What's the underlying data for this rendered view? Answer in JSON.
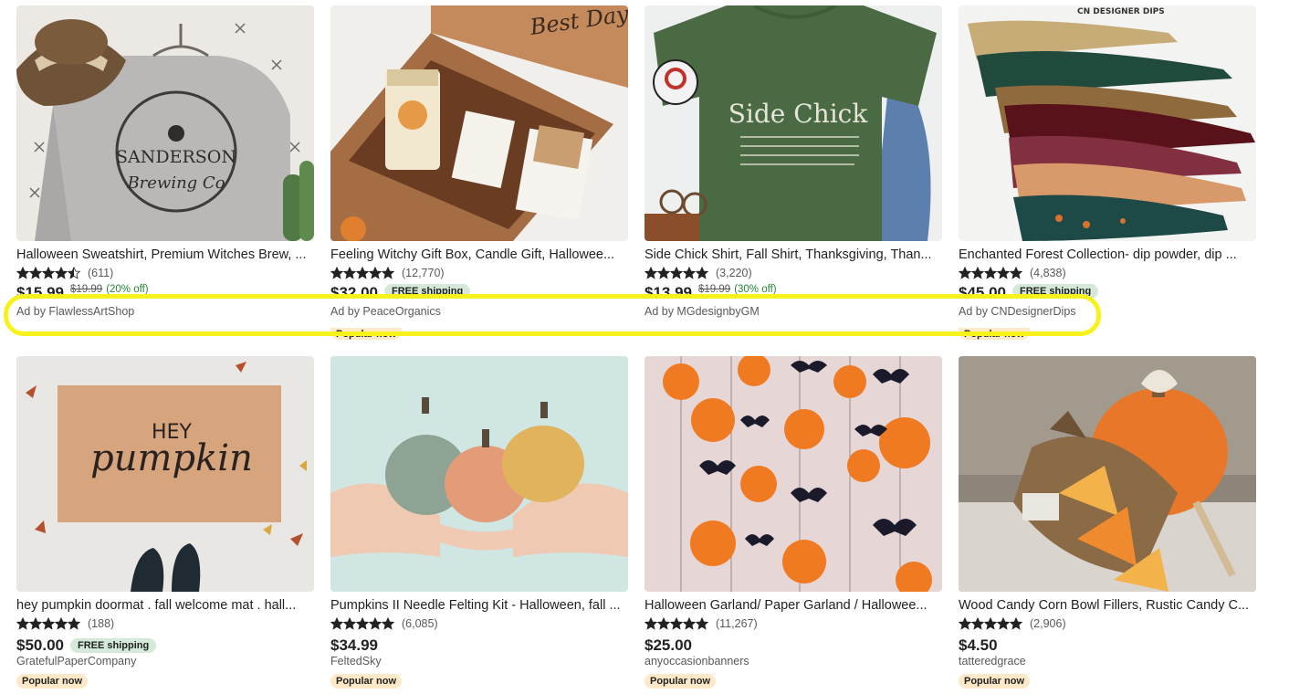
{
  "highlight_color": "#f7f21c",
  "listings": [
    {
      "title": "Halloween Sweatshirt, Premium Witches Brew, ...",
      "stars": 4.5,
      "reviews": "(611)",
      "price": "$15.99",
      "original": "$19.99",
      "discount": "(20% off)",
      "shipping": "",
      "ad": "Ad by FlawlessArtShop",
      "shop": "",
      "badge": "",
      "image": "sweatshirt"
    },
    {
      "title": "Feeling Witchy Gift Box, Candle Gift, Hallowee...",
      "stars": 5,
      "reviews": "(12,770)",
      "price": "$32.00",
      "original": "",
      "discount": "",
      "shipping": "FREE shipping",
      "ad": "Ad by PeaceOrganics",
      "shop": "",
      "badge": "Popular now",
      "image": "giftbox"
    },
    {
      "title": "Side Chick Shirt, Fall Shirt, Thanksgiving, Than...",
      "stars": 5,
      "reviews": "(3,220)",
      "price": "$13.99",
      "original": "$19.99",
      "discount": "(30% off)",
      "shipping": "",
      "ad": "Ad by MGdesignbyGM",
      "shop": "",
      "badge": "",
      "image": "tshirt"
    },
    {
      "title": "Enchanted Forest Collection- dip powder, dip ...",
      "stars": 5,
      "reviews": "(4,838)",
      "price": "$45.00",
      "original": "",
      "discount": "",
      "shipping": "FREE shipping",
      "ad": "Ad by CNDesignerDips",
      "shop": "",
      "badge": "Popular now",
      "image": "nails",
      "image_text": "CN DESIGNER DIPS"
    },
    {
      "title": "hey pumpkin doormat . fall welcome mat . hall...",
      "stars": 5,
      "reviews": "(188)",
      "price": "$50.00",
      "original": "",
      "discount": "",
      "shipping": "FREE shipping",
      "ad": "",
      "shop": "GratefulPaperCompany",
      "badge": "Popular now",
      "image": "doormat"
    },
    {
      "title": "Pumpkins II Needle Felting Kit - Halloween, fall ...",
      "stars": 5,
      "reviews": "(6,085)",
      "price": "$34.99",
      "original": "",
      "discount": "",
      "shipping": "",
      "ad": "",
      "shop": "FeltedSky",
      "badge": "Popular now",
      "image": "felt"
    },
    {
      "title": "Halloween Garland/ Paper Garland / Hallowee...",
      "stars": 5,
      "reviews": "(11,267)",
      "price": "$25.00",
      "original": "",
      "discount": "",
      "shipping": "",
      "ad": "",
      "shop": "anyoccasionbanners",
      "badge": "Popular now",
      "image": "garland"
    },
    {
      "title": "Wood Candy Corn Bowl Fillers, Rustic Candy C...",
      "stars": 5,
      "reviews": "(2,906)",
      "price": "$4.50",
      "original": "",
      "discount": "",
      "shipping": "",
      "ad": "",
      "shop": "tatteredgrace",
      "badge": "Popular now",
      "image": "candycorn"
    }
  ]
}
